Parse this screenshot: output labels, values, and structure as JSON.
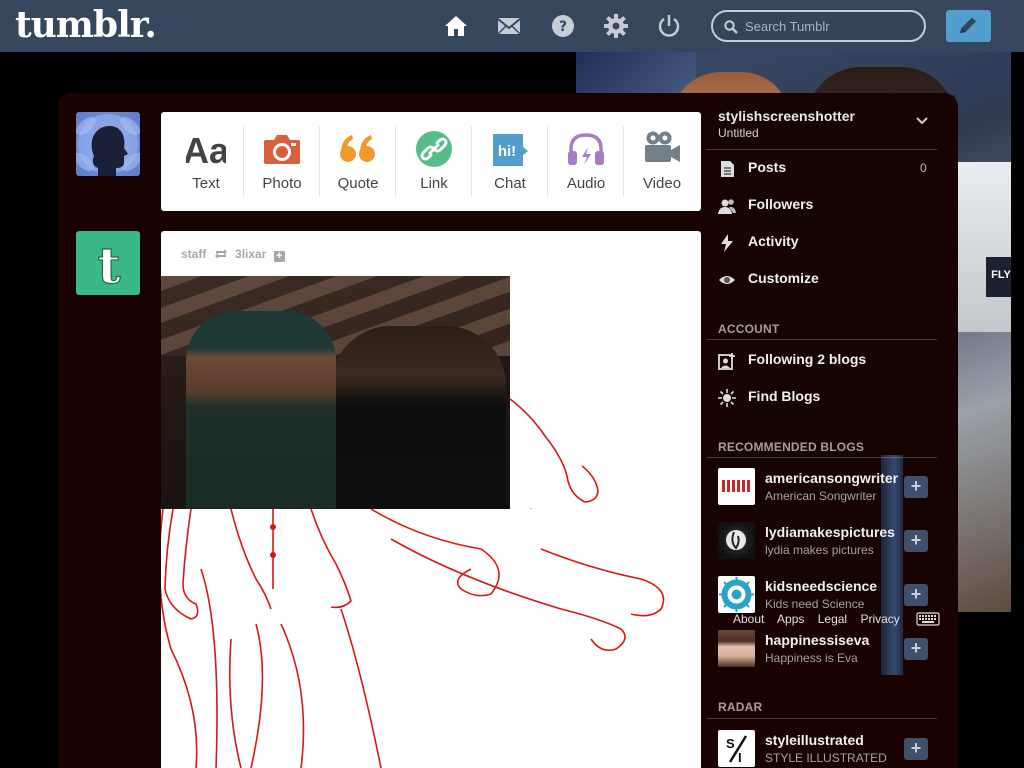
{
  "header": {
    "logo": "tumblr.",
    "search_placeholder": "Search Tumblr"
  },
  "post_types": [
    {
      "label": "Text",
      "icon": "text-icon",
      "color": "#444444"
    },
    {
      "label": "Photo",
      "icon": "camera-icon",
      "color": "#d95e40"
    },
    {
      "label": "Quote",
      "icon": "quote-icon",
      "color": "#f2992e"
    },
    {
      "label": "Link",
      "icon": "link-icon",
      "color": "#56bc8a"
    },
    {
      "label": "Chat",
      "icon": "chat-icon",
      "color": "#529ecc"
    },
    {
      "label": "Audio",
      "icon": "headphones-icon",
      "color": "#a77dc2"
    },
    {
      "label": "Video",
      "icon": "video-camera-icon",
      "color": "#748089"
    }
  ],
  "post": {
    "author": "staff",
    "reblogged_from": "3lixar",
    "follow_glyph": "+"
  },
  "sidebar": {
    "blog_name": "stylishscreenshotter",
    "blog_title": "Untitled",
    "nav": [
      {
        "label": "Posts",
        "count": "0",
        "icon": "posts-icon"
      },
      {
        "label": "Followers",
        "count": "",
        "icon": "followers-icon"
      },
      {
        "label": "Activity",
        "count": "",
        "icon": "activity-icon"
      },
      {
        "label": "Customize",
        "count": "",
        "icon": "eye-icon"
      }
    ],
    "account_header": "ACCOUNT",
    "account_nav": [
      {
        "label": "Following 2 blogs",
        "icon": "following-icon"
      },
      {
        "label": "Find Blogs",
        "icon": "find-blogs-icon"
      }
    ],
    "recommended_header": "RECOMMENDED BLOGS",
    "recommended": [
      {
        "name": "americansongwriter",
        "title": "American Songwriter"
      },
      {
        "name": "lydiamakespictures",
        "title": "lydia makes pictures"
      },
      {
        "name": "kidsneedscience",
        "title": "Kids need Science"
      },
      {
        "name": "happinessiseva",
        "title": "Happiness is Eva"
      }
    ],
    "radar_header": "RADAR",
    "radar": [
      {
        "name": "styleillustrated",
        "title": "STYLE ILLUSTRATED"
      }
    ],
    "follow_glyph": "+"
  },
  "footer": {
    "links": [
      "About",
      "Apps",
      "Legal",
      "Privacy"
    ]
  },
  "background": {
    "plate_text": "FLY"
  }
}
